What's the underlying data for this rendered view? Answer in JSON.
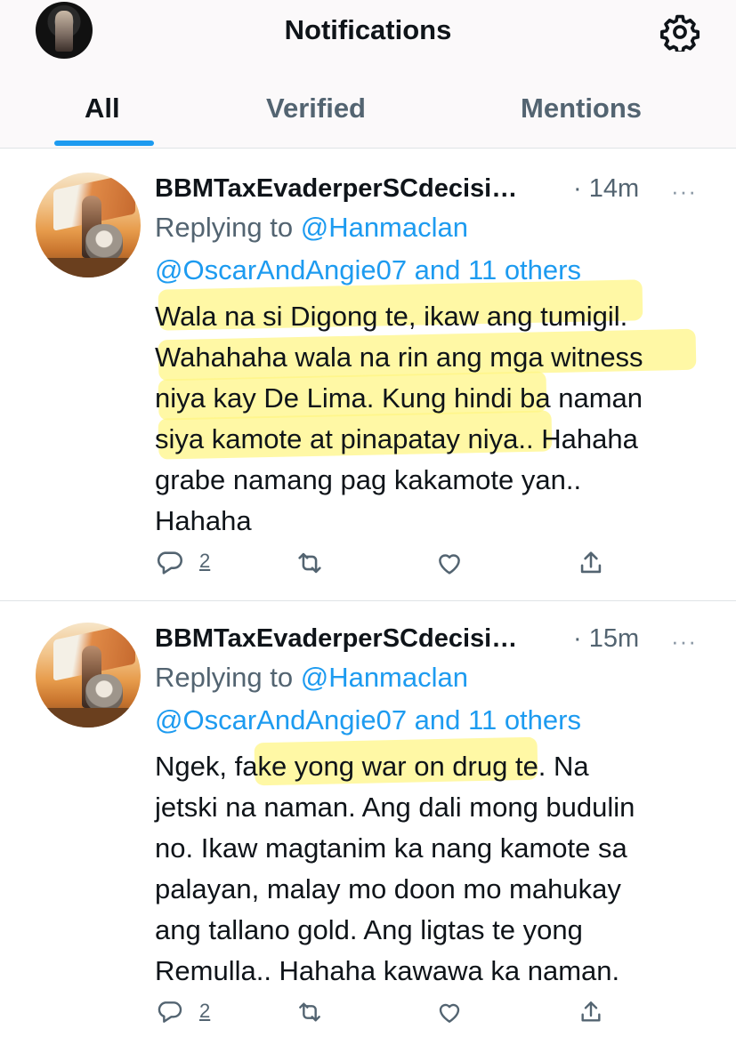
{
  "header": {
    "title": "Notifications",
    "icons": [
      "profile-avatar",
      "gear-icon"
    ]
  },
  "tabs": [
    {
      "label": "All",
      "active": true
    },
    {
      "label": "Verified",
      "active": false
    },
    {
      "label": "Mentions",
      "active": false
    }
  ],
  "colors": {
    "accent": "#1d9bf0",
    "muted": "#536471",
    "text": "#0f1419",
    "highlight": "#fff582"
  },
  "tweets": [
    {
      "name": "BBMTaxEvaderperSCdecisi…",
      "time": "· 14m",
      "more": "···",
      "replying_prefix": "Replying to ",
      "replying_to_1": "@Hanmaclan",
      "replying_to_2": "@OscarAndAngie07 and 11 others",
      "lines": [
        "Wala na si Digong te, ikaw ang tumigil.",
        "Wahahaha wala na rin ang mga witness",
        "niya kay De Lima. Kung hindi ba naman",
        "siya kamote at pinapatay niya.. Hahaha",
        "grabe namang pag kakamote yan..",
        "Hahaha"
      ],
      "reply_count": "2"
    },
    {
      "name": "BBMTaxEvaderperSCdecisi…",
      "time": "· 15m",
      "more": "···",
      "replying_prefix": "Replying to ",
      "replying_to_1": "@Hanmaclan",
      "replying_to_2": "@OscarAndAngie07 and 11 others",
      "lines": [
        "Ngek, fake yong war on drug te. Na",
        "jetski na naman. Ang dali mong budulin",
        "no. Ikaw magtanim ka nang kamote sa",
        "palayan, malay mo doon mo mahukay",
        "ang tallano gold. Ang ligtas te yong",
        "Remulla.. Hahaha kawawa ka naman."
      ],
      "reply_count": "2"
    }
  ]
}
